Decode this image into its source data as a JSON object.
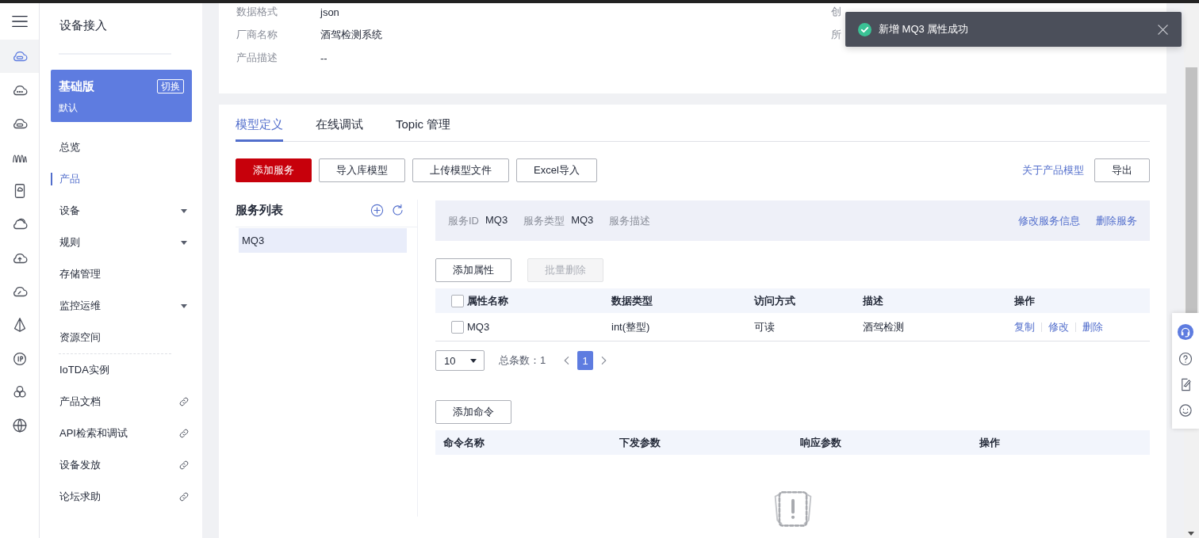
{
  "nav_rail": {
    "items": [
      {
        "selected": true
      },
      {
        "selected": false
      },
      {
        "selected": false
      },
      {
        "selected": false
      },
      {
        "selected": false
      },
      {
        "selected": false
      },
      {
        "selected": false
      },
      {
        "selected": false
      },
      {
        "selected": false
      },
      {
        "selected": false
      },
      {
        "selected": false
      },
      {
        "selected": false
      }
    ]
  },
  "sidebar": {
    "title": "设备接入",
    "edition": {
      "name": "基础版",
      "switch": "切换",
      "instance": "默认"
    },
    "items": [
      {
        "label": "总览",
        "kind": "plain",
        "selected": false
      },
      {
        "label": "产品",
        "kind": "plain",
        "selected": true
      },
      {
        "label": "设备",
        "kind": "menu",
        "selected": false
      },
      {
        "label": "规则",
        "kind": "menu",
        "selected": false
      },
      {
        "label": "存储管理",
        "kind": "plain",
        "selected": false
      },
      {
        "label": "监控运维",
        "kind": "menu",
        "selected": false
      },
      {
        "label": "资源空间",
        "kind": "plain",
        "selected": false
      },
      {
        "label": "IoTDA实例",
        "kind": "plain",
        "selected": false,
        "group_start": true
      },
      {
        "label": "产品文档",
        "kind": "link",
        "selected": false
      },
      {
        "label": "API检索和调试",
        "kind": "link",
        "selected": false
      },
      {
        "label": "设备发放",
        "kind": "link",
        "selected": false
      },
      {
        "label": "论坛求助",
        "kind": "link",
        "selected": false
      }
    ]
  },
  "product_info": {
    "rows": [
      {
        "label": "数据格式",
        "value": "json",
        "right_label": "创"
      },
      {
        "label": "厂商名称",
        "value": "酒驾检测系统",
        "right_label": "所"
      },
      {
        "label": "产品描述",
        "value": "--"
      }
    ]
  },
  "tabs": [
    {
      "label": "模型定义",
      "selected": true
    },
    {
      "label": "在线调试",
      "selected": false
    },
    {
      "label": "Topic 管理",
      "selected": false
    }
  ],
  "toolbar": {
    "buttons": [
      {
        "label": "添加服务",
        "kind": "primary"
      },
      {
        "label": "导入库模型",
        "kind": "default"
      },
      {
        "label": "上传模型文件",
        "kind": "default"
      },
      {
        "label": "Excel导入",
        "kind": "default"
      }
    ],
    "link": "关于产品模型",
    "export": "导出"
  },
  "service_list": {
    "title": "服务列表",
    "items": [
      {
        "label": "MQ3",
        "selected": true
      }
    ]
  },
  "service_header": {
    "fields": [
      {
        "label": "服务ID",
        "value": "MQ3"
      },
      {
        "label": "服务类型",
        "value": "MQ3"
      },
      {
        "label": "服务描述"
      }
    ],
    "actions": [
      "修改服务信息",
      "删除服务"
    ]
  },
  "property_buttons": [
    {
      "label": "添加属性",
      "disabled": false
    },
    {
      "label": "批量删除",
      "disabled": true
    }
  ],
  "property_table": {
    "select_all_checked": false,
    "columns": [
      "属性名称",
      "数据类型",
      "访问方式",
      "描述",
      "操作"
    ],
    "rows": [
      {
        "checked": false,
        "cells": [
          "MQ3",
          "int(整型)",
          "可读",
          "酒驾检测"
        ],
        "actions": [
          "复制",
          "修改",
          "删除"
        ]
      }
    ]
  },
  "pagination": {
    "page_size": "10",
    "total": "总条数：1",
    "pages": [
      {
        "label": "1",
        "selected": true
      }
    ]
  },
  "commands": {
    "button": "添加命令",
    "columns": [
      "命令名称",
      "下发参数",
      "响应参数",
      "操作"
    ]
  },
  "toast": {
    "message": "新增 MQ3 属性成功"
  }
}
